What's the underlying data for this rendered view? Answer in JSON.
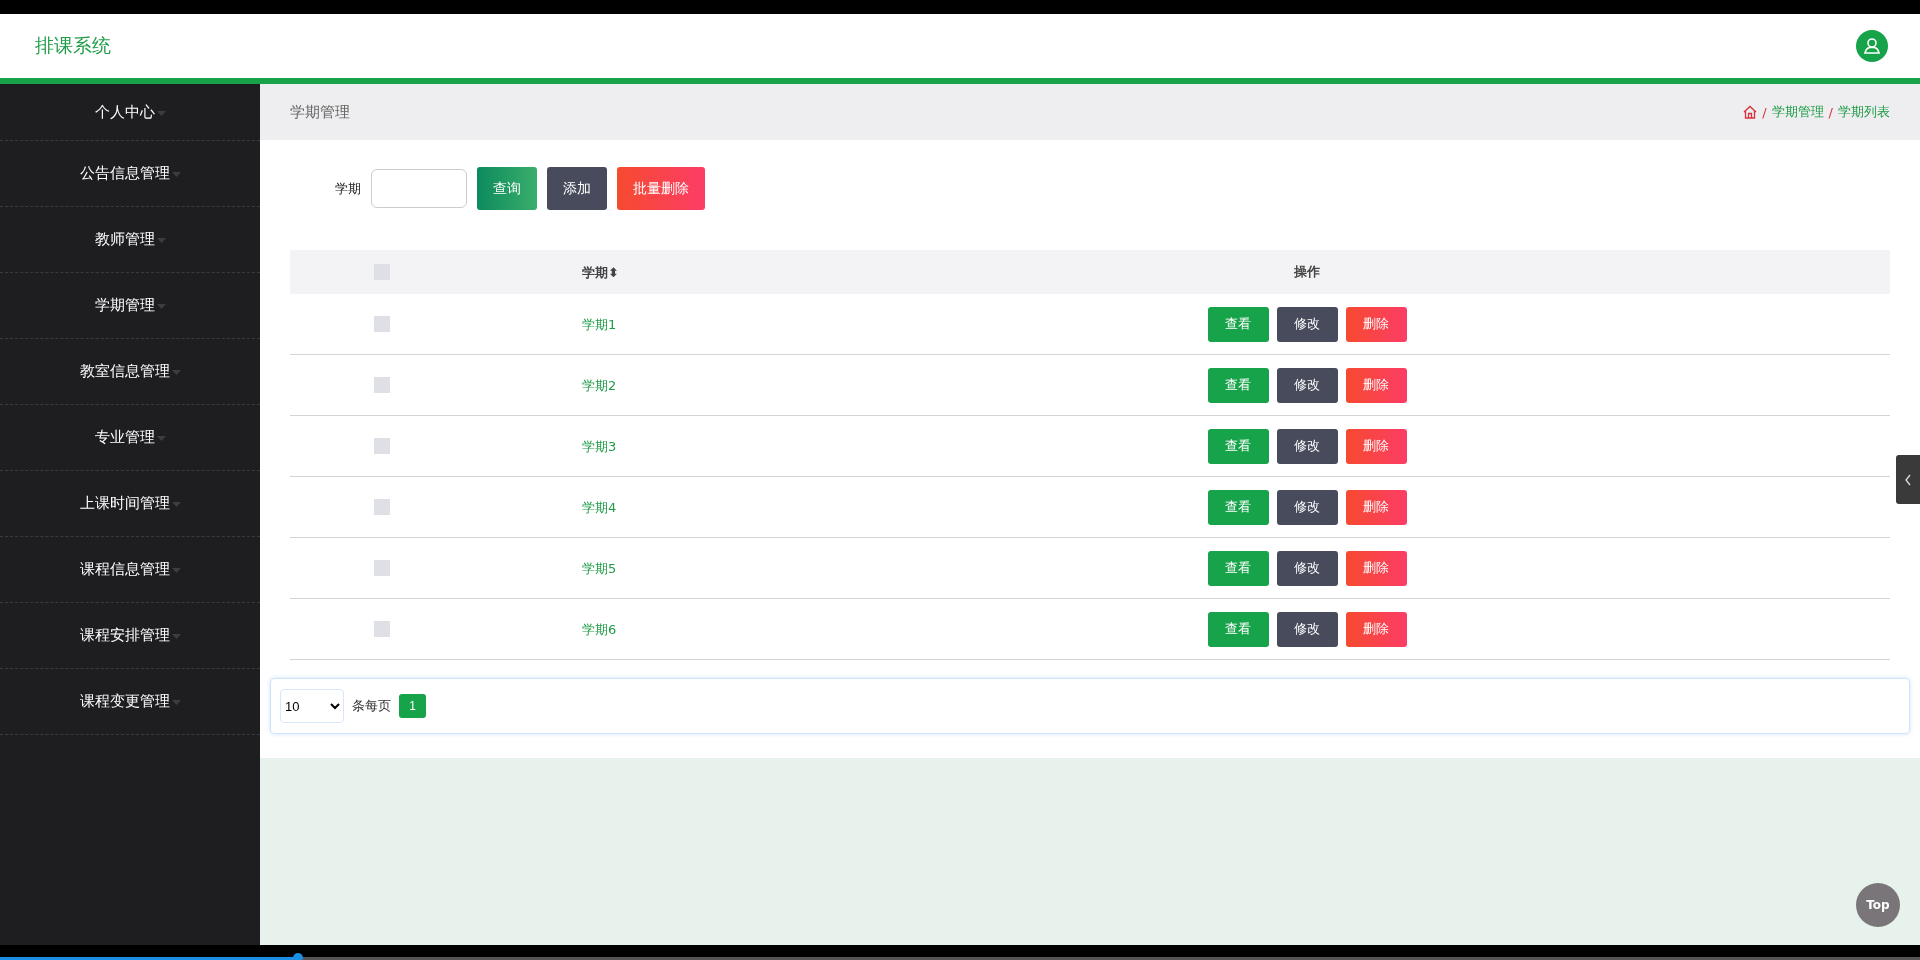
{
  "header": {
    "title": "排课系统"
  },
  "sidebar": {
    "items": [
      {
        "label": "个人中心"
      },
      {
        "label": "公告信息管理"
      },
      {
        "label": "教师管理"
      },
      {
        "label": "学期管理"
      },
      {
        "label": "教室信息管理"
      },
      {
        "label": "专业管理"
      },
      {
        "label": "上课时间管理"
      },
      {
        "label": "课程信息管理"
      },
      {
        "label": "课程安排管理"
      },
      {
        "label": "课程变更管理"
      }
    ]
  },
  "page_title": "学期管理",
  "breadcrumb": [
    {
      "separator": "/",
      "label": "学期管理"
    },
    {
      "separator": "/",
      "label": "学期列表"
    }
  ],
  "search": {
    "label": "学期",
    "buttons": [
      {
        "label": "查询",
        "kind": "query"
      },
      {
        "label": "添加",
        "kind": "add"
      },
      {
        "label": "批量删除",
        "kind": "delete"
      }
    ]
  },
  "table": {
    "columns": [
      "学期",
      "操作"
    ],
    "sort_icon": "⬍",
    "all_checked": false,
    "rows": [
      {
        "name": "学期1",
        "checked": false,
        "actions": [
          {
            "label": "查看",
            "kind": "view"
          },
          {
            "label": "修改",
            "kind": "edit"
          },
          {
            "label": "删除",
            "kind": "delete"
          }
        ]
      },
      {
        "name": "学期2",
        "checked": false,
        "actions": [
          {
            "label": "查看",
            "kind": "view"
          },
          {
            "label": "修改",
            "kind": "edit"
          },
          {
            "label": "删除",
            "kind": "delete"
          }
        ]
      },
      {
        "name": "学期3",
        "checked": false,
        "actions": [
          {
            "label": "查看",
            "kind": "view"
          },
          {
            "label": "修改",
            "kind": "edit"
          },
          {
            "label": "删除",
            "kind": "delete"
          }
        ]
      },
      {
        "name": "学期4",
        "checked": false,
        "actions": [
          {
            "label": "查看",
            "kind": "view"
          },
          {
            "label": "修改",
            "kind": "edit"
          },
          {
            "label": "删除",
            "kind": "delete"
          }
        ]
      },
      {
        "name": "学期5",
        "checked": false,
        "actions": [
          {
            "label": "查看",
            "kind": "view"
          },
          {
            "label": "修改",
            "kind": "edit"
          },
          {
            "label": "删除",
            "kind": "delete"
          }
        ]
      },
      {
        "name": "学期6",
        "checked": false,
        "actions": [
          {
            "label": "查看",
            "kind": "view"
          },
          {
            "label": "修改",
            "kind": "edit"
          },
          {
            "label": "删除",
            "kind": "delete"
          }
        ]
      }
    ]
  },
  "pagination": {
    "page_size": "10",
    "per_page_label": "条每页",
    "pages": [
      {
        "label": "1",
        "selected": true
      }
    ]
  },
  "top_button": "Top",
  "player": {
    "level": 0.155
  }
}
